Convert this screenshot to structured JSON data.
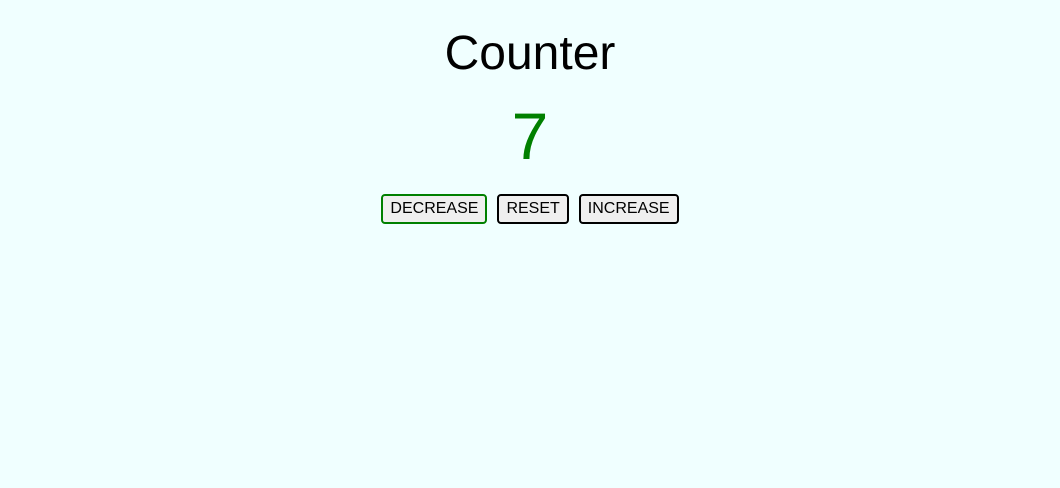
{
  "page": {
    "title": "Counter"
  },
  "counter": {
    "value": "7",
    "value_color": "#008000"
  },
  "buttons": {
    "decrease": "DECREASE",
    "reset": "RESET",
    "increase": "INCREASE"
  },
  "colors": {
    "background": "#f0ffff",
    "focus_border": "#008000",
    "button_border": "#000000",
    "button_fill": "#efefef"
  }
}
